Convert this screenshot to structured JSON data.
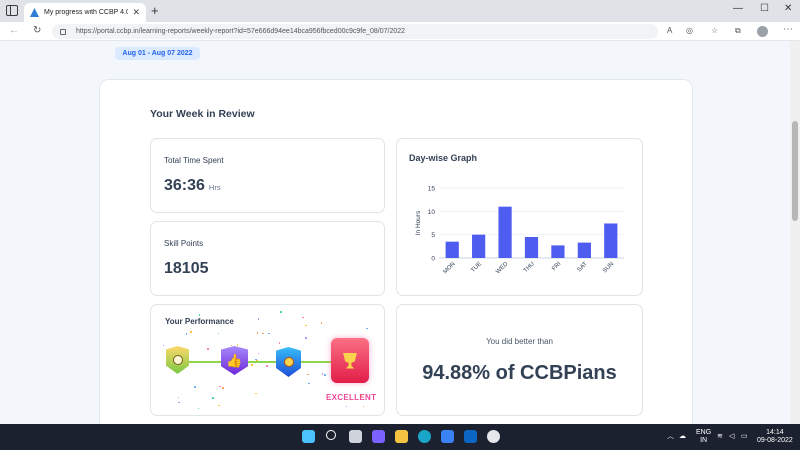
{
  "browser": {
    "tab_title": "My progress with CCBP 4.0 Aca",
    "tab_close": "✕",
    "new_tab": "+",
    "url": "https://portal.ccbp.in/learning-reports/weekly-report?id=57e666d94ee14bca956fbced00c9c9fe_08/07/2022",
    "window_controls": [
      "—",
      "☐",
      "✕"
    ]
  },
  "report": {
    "date_range": "Aug 01 - Aug 07 2022",
    "heading": "Your Week in Review",
    "time_spent": {
      "label": "Total Time Spent",
      "value": "36:36",
      "unit": "Hrs"
    },
    "skill_points": {
      "label": "Skill Points",
      "value": "18105"
    },
    "graph_title": "Day-wise Graph",
    "performance": {
      "title": "Your Performance",
      "level": "EXCELLENT"
    },
    "better": {
      "label": "You did better than",
      "value": "94.88% of CCBPians"
    }
  },
  "chart_data": {
    "type": "bar",
    "categories": [
      "MON",
      "TUE",
      "WED",
      "THU",
      "FRI",
      "SAT",
      "SUN"
    ],
    "values": [
      3.5,
      5,
      11,
      4.5,
      2.7,
      3.3,
      7.4
    ],
    "ylabel": "In Hours",
    "yticks": [
      0,
      5,
      10,
      15
    ],
    "ylim": [
      0,
      15
    ],
    "bar_color": "#4f5cf0",
    "grid": true
  },
  "colors": {
    "accent": "#2563eb",
    "pill_bg": "#dbeafe",
    "excellent": "#ec4899"
  },
  "taskbar": {
    "lang_top": "ENG",
    "lang_bottom": "IN",
    "time": "14:14",
    "date": "09-08-2022"
  }
}
